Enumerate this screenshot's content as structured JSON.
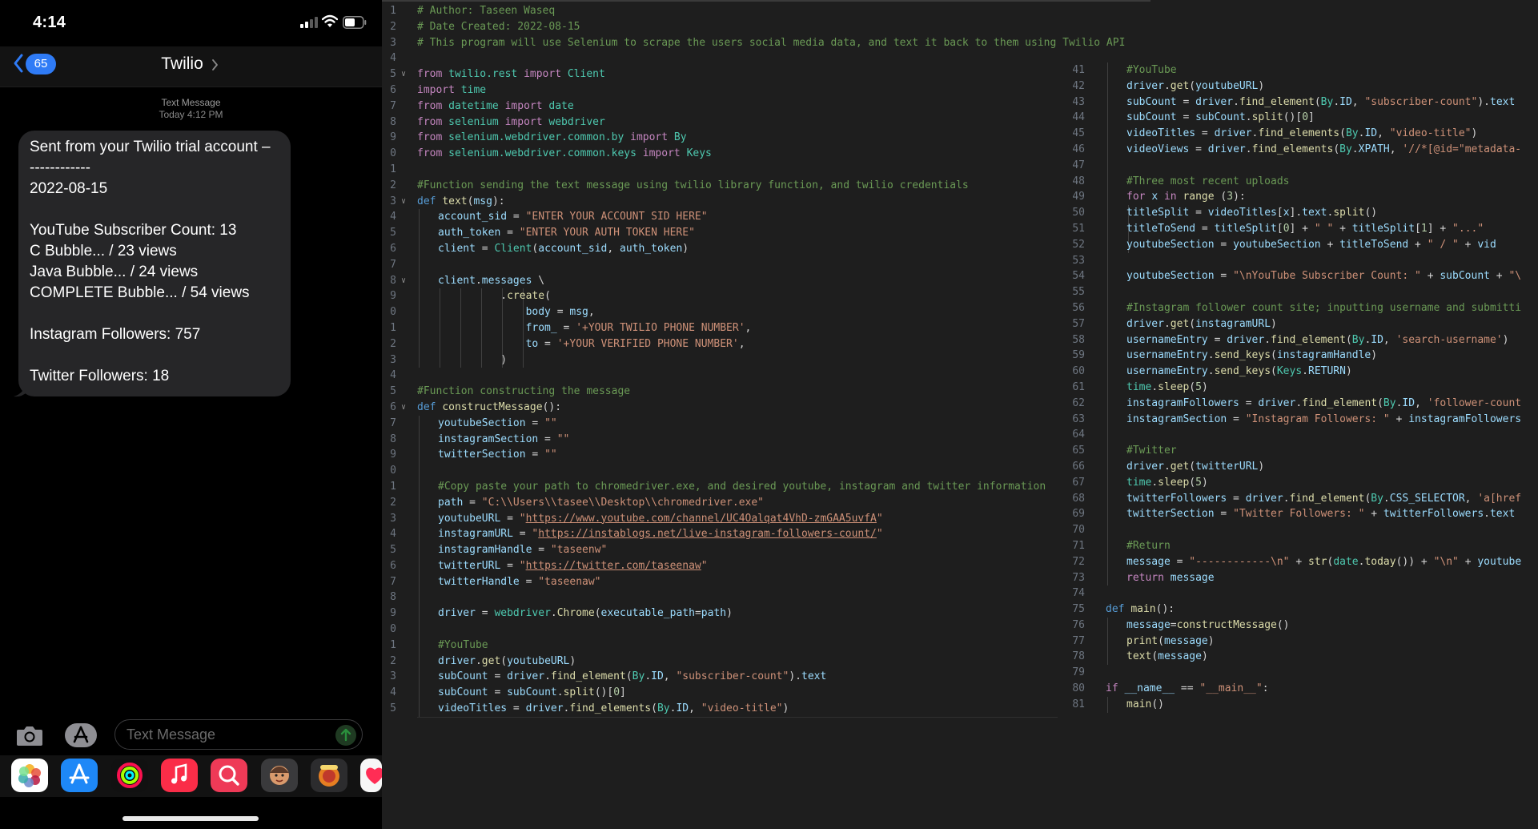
{
  "phone": {
    "status": {
      "time": "4:14"
    },
    "nav": {
      "unread_count": "65",
      "contact": "Twilio"
    },
    "thread": {
      "label": "Text Message",
      "timestamp": "Today 4:12 PM"
    },
    "message_lines": [
      "Sent from your Twilio trial account –",
      "------------",
      "2022-08-15",
      "",
      "YouTube Subscriber Count: 13",
      "C Bubble... / 23 views",
      "Java Bubble... / 24 views",
      "COMPLETE Bubble... / 54 views",
      "",
      "Instagram Followers: 757",
      "",
      "Twitter Followers: 18"
    ],
    "composer": {
      "placeholder": "Text Message"
    },
    "icons": {
      "camera": "camera-icon",
      "apps": "app-store-icon",
      "send": "send-arrow-icon"
    },
    "drawer_apps": [
      "photos-icon",
      "app-store-icon",
      "activity-icon",
      "music-icon",
      "search-icon",
      "memoji-icon",
      "avatar-icon",
      "heart-icon"
    ],
    "colors": {
      "badge": "#2f7bf6",
      "bubble": "#262628"
    }
  },
  "editor": {
    "left_pane": [
      {
        "n": "1",
        "fold": false,
        "indent": 0,
        "html": "<span class='cm'># Author: Taseen Waseq</span>"
      },
      {
        "n": "2",
        "fold": false,
        "indent": 0,
        "html": "<span class='cm'># Date Created: 2022-08-15</span>"
      },
      {
        "n": "3",
        "fold": false,
        "indent": 0,
        "html": "<span class='cm'># This program will use Selenium to scrape the users social media data, and text it back to them using Twilio API</span>"
      },
      {
        "n": "4",
        "fold": false,
        "indent": 0,
        "html": ""
      },
      {
        "n": "5",
        "fold": true,
        "indent": 0,
        "html": "<span class='kw'>from</span> <span class='cls'>twilio.rest</span> <span class='kw'>import</span> <span class='cls'>Client</span>"
      },
      {
        "n": "6",
        "fold": false,
        "indent": 0,
        "html": "<span class='kw'>import</span> <span class='cls'>time</span>"
      },
      {
        "n": "7",
        "fold": false,
        "indent": 0,
        "html": "<span class='kw'>from</span> <span class='cls'>datetime</span> <span class='kw'>import</span> <span class='cls'>date</span>"
      },
      {
        "n": "8",
        "fold": false,
        "indent": 0,
        "html": "<span class='kw'>from</span> <span class='cls'>selenium</span> <span class='kw'>import</span> <span class='cls'>webdriver</span>"
      },
      {
        "n": "9",
        "fold": false,
        "indent": 0,
        "html": "<span class='kw'>from</span> <span class='cls'>selenium.webdriver.common.by</span> <span class='kw'>import</span> <span class='cls'>By</span>"
      },
      {
        "n": "0",
        "fold": false,
        "indent": 0,
        "html": "<span class='kw'>from</span> <span class='cls'>selenium.webdriver.common.keys</span> <span class='kw'>import</span> <span class='cls'>Keys</span>"
      },
      {
        "n": "1",
        "fold": false,
        "indent": 0,
        "html": ""
      },
      {
        "n": "2",
        "fold": false,
        "indent": 0,
        "html": "<span class='cm'>#Function sending the text message using twilio library function, and twilio credentials</span>"
      },
      {
        "n": "3",
        "fold": true,
        "indent": 0,
        "html": "<span class='df'>def</span> <span class='fn'>text</span>(<span class='var'>msg</span>):"
      },
      {
        "n": "4",
        "fold": false,
        "indent": 1,
        "html": "<span class='var'>account_sid</span> = <span class='str'>\"ENTER YOUR ACCOUNT SID HERE\"</span>"
      },
      {
        "n": "5",
        "fold": false,
        "indent": 1,
        "html": "<span class='var'>auth_token</span> = <span class='str'>\"ENTER YOUR AUTH TOKEN HERE\"</span>"
      },
      {
        "n": "6",
        "fold": false,
        "indent": 1,
        "html": "<span class='var'>client</span> = <span class='cls'>Client</span>(<span class='var'>account_sid</span>, <span class='var'>auth_token</span>)"
      },
      {
        "n": "7",
        "fold": false,
        "indent": 1,
        "html": ""
      },
      {
        "n": "8",
        "fold": true,
        "indent": 1,
        "html": "<span class='var'>client</span>.<span class='var'>messages</span> \\"
      },
      {
        "n": "9",
        "fold": false,
        "indent": 6,
        "html": "          .<span class='fn'>create</span>("
      },
      {
        "n": "0",
        "fold": false,
        "indent": 6,
        "html": "              <span class='var'>body</span> = <span class='var'>msg</span>,"
      },
      {
        "n": "1",
        "fold": false,
        "indent": 6,
        "html": "              <span class='var'>from_</span> = <span class='str'>'+YOUR TWILIO PHONE NUMBER'</span>,"
      },
      {
        "n": "2",
        "fold": false,
        "indent": 6,
        "html": "              <span class='var'>to</span> = <span class='str'>'+YOUR VERIFIED PHONE NUMBER'</span>,"
      },
      {
        "n": "3",
        "fold": false,
        "indent": 6,
        "html": "          )"
      },
      {
        "n": "4",
        "fold": false,
        "indent": 0,
        "html": ""
      },
      {
        "n": "5",
        "fold": false,
        "indent": 0,
        "html": "<span class='cm'>#Function constructing the message</span>"
      },
      {
        "n": "6",
        "fold": true,
        "indent": 0,
        "html": "<span class='df'>def</span> <span class='fn'>constructMessage</span>():"
      },
      {
        "n": "7",
        "fold": false,
        "indent": 1,
        "html": "<span class='var'>youtubeSection</span> = <span class='str'>\"\"</span>"
      },
      {
        "n": "8",
        "fold": false,
        "indent": 1,
        "html": "<span class='var'>instagramSection</span> = <span class='str'>\"\"</span>"
      },
      {
        "n": "9",
        "fold": false,
        "indent": 1,
        "html": "<span class='var'>twitterSection</span> = <span class='str'>\"\"</span>"
      },
      {
        "n": "0",
        "fold": false,
        "indent": 1,
        "html": ""
      },
      {
        "n": "1",
        "fold": false,
        "indent": 1,
        "html": "<span class='cm'>#Copy paste your path to chromedriver.exe, and desired youtube, instagram and twitter information</span>"
      },
      {
        "n": "2",
        "fold": false,
        "indent": 1,
        "html": "<span class='var'>path</span> = <span class='str'>\"C:\\\\Users\\\\tasee\\\\Desktop\\\\chromedriver.exe\"</span>"
      },
      {
        "n": "3",
        "fold": false,
        "indent": 1,
        "html": "<span class='var'>youtubeURL</span> = <span class='str'>\"<span class='u'>https://www.youtube.com/channel/UC4Oalqat4VhD-zmGAA5uvfA</span>\"</span>"
      },
      {
        "n": "4",
        "fold": false,
        "indent": 1,
        "html": "<span class='var'>instagramURL</span> = <span class='str'>\"<span class='u'>https://instablogs.net/live-instagram-followers-count/</span>\"</span>"
      },
      {
        "n": "5",
        "fold": false,
        "indent": 1,
        "html": "<span class='var'>instagramHandle</span> = <span class='str'>\"taseenw\"</span>"
      },
      {
        "n": "6",
        "fold": false,
        "indent": 1,
        "html": "<span class='var'>twitterURL</span> = <span class='str'>\"<span class='u'>https://twitter.com/taseenaw</span>\"</span>"
      },
      {
        "n": "7",
        "fold": false,
        "indent": 1,
        "html": "<span class='var'>twitterHandle</span> = <span class='str'>\"taseenaw\"</span>"
      },
      {
        "n": "8",
        "fold": false,
        "indent": 1,
        "html": ""
      },
      {
        "n": "9",
        "fold": false,
        "indent": 1,
        "html": "<span class='var'>driver</span> = <span class='cls'>webdriver</span>.<span class='fn'>Chrome</span>(<span class='var'>executable_path</span>=<span class='var'>path</span>)"
      },
      {
        "n": "0",
        "fold": false,
        "indent": 1,
        "html": ""
      },
      {
        "n": "1",
        "fold": false,
        "indent": 1,
        "html": "<span class='cm'>#YouTube</span>"
      },
      {
        "n": "2",
        "fold": false,
        "indent": 1,
        "html": "<span class='var'>driver</span>.<span class='fn'>get</span>(<span class='var'>youtubeURL</span>)"
      },
      {
        "n": "3",
        "fold": false,
        "indent": 1,
        "html": "<span class='var'>subCount</span> = <span class='var'>driver</span>.<span class='fn'>find_element</span>(<span class='cls'>By</span>.<span class='var'>ID</span>, <span class='str'>\"subscriber-count\"</span>).<span class='var'>text</span>"
      },
      {
        "n": "4",
        "fold": false,
        "indent": 1,
        "html": "<span class='var'>subCount</span> = <span class='var'>subCount</span>.<span class='fn'>split</span>()[<span class='num'>0</span>]"
      },
      {
        "n": "5",
        "fold": false,
        "indent": 1,
        "html": "<span class='var'>videoTitles</span> = <span class='var'>driver</span>.<span class='fn'>find_elements</span>(<span class='cls'>By</span>.<span class='var'>ID</span>, <span class='str'>\"video-title\"</span>)"
      }
    ],
    "right_pane": [
      {
        "n": "41",
        "fold": false,
        "indent": 1,
        "html": "<span class='cm'>#YouTube</span>"
      },
      {
        "n": "42",
        "fold": false,
        "indent": 1,
        "html": "<span class='var'>driver</span>.<span class='fn'>get</span>(<span class='var'>youtubeURL</span>)"
      },
      {
        "n": "43",
        "fold": false,
        "indent": 1,
        "html": "<span class='var'>subCount</span> = <span class='var'>driver</span>.<span class='fn'>find_element</span>(<span class='cls'>By</span>.<span class='var'>ID</span>, <span class='str'>\"subscriber-count\"</span>).<span class='var'>text</span>"
      },
      {
        "n": "44",
        "fold": false,
        "indent": 1,
        "html": "<span class='var'>subCount</span> = <span class='var'>subCount</span>.<span class='fn'>split</span>()[<span class='num'>0</span>]"
      },
      {
        "n": "45",
        "fold": false,
        "indent": 1,
        "html": "<span class='var'>videoTitles</span> = <span class='var'>driver</span>.<span class='fn'>find_elements</span>(<span class='cls'>By</span>.<span class='var'>ID</span>, <span class='str'>\"video-title\"</span>)"
      },
      {
        "n": "46",
        "fold": false,
        "indent": 1,
        "html": "<span class='var'>videoViews</span> = <span class='var'>driver</span>.<span class='fn'>find_elements</span>(<span class='cls'>By</span>.<span class='var'>XPATH</span>, <span class='str'>'//*[@id=\"metadata-</span>"
      },
      {
        "n": "47",
        "fold": false,
        "indent": 1,
        "html": ""
      },
      {
        "n": "48",
        "fold": false,
        "indent": 1,
        "html": "<span class='cm'>#Three most recent uploads</span>"
      },
      {
        "n": "49",
        "fold": false,
        "indent": 1,
        "html": "<span class='kw'>for</span> <span class='var'>x</span> <span class='kw'>in</span> <span class='fn'>range</span> (<span class='num'>3</span>):"
      },
      {
        "n": "50",
        "fold": false,
        "indent": 2,
        "html": "<span class='var'>titleSplit</span> = <span class='var'>videoTitles</span>[<span class='var'>x</span>].<span class='var'>text</span>.<span class='fn'>split</span>()"
      },
      {
        "n": "51",
        "fold": false,
        "indent": 2,
        "html": "<span class='var'>titleToSend</span> = <span class='var'>titleSplit</span>[<span class='num'>0</span>] + <span class='str'>\" \"</span> + <span class='var'>titleSplit</span>[<span class='num'>1</span>] + <span class='str'>\"...\"</span>"
      },
      {
        "n": "52",
        "fold": false,
        "indent": 2,
        "html": "<span class='var'>youtubeSection</span> = <span class='var'>youtubeSection</span> + <span class='var'>titleToSend</span> + <span class='str'>\" / \"</span> + <span class='var'>vid</span>"
      },
      {
        "n": "53",
        "fold": false,
        "indent": 1,
        "html": ""
      },
      {
        "n": "54",
        "fold": false,
        "indent": 1,
        "html": "<span class='var'>youtubeSection</span> = <span class='str'>\"\\nYouTube Subscriber Count: \"</span> + <span class='var'>subCount</span> + <span class='str'>\"\\</span>"
      },
      {
        "n": "55",
        "fold": false,
        "indent": 1,
        "html": ""
      },
      {
        "n": "56",
        "fold": false,
        "indent": 1,
        "html": "<span class='cm'>#Instagram follower count site; inputting username and submitti</span>"
      },
      {
        "n": "57",
        "fold": false,
        "indent": 1,
        "html": "<span class='var'>driver</span>.<span class='fn'>get</span>(<span class='var'>instagramURL</span>)"
      },
      {
        "n": "58",
        "fold": false,
        "indent": 1,
        "html": "<span class='var'>usernameEntry</span> = <span class='var'>driver</span>.<span class='fn'>find_element</span>(<span class='cls'>By</span>.<span class='var'>ID</span>, <span class='str'>'search-username'</span>)"
      },
      {
        "n": "59",
        "fold": false,
        "indent": 1,
        "html": "<span class='var'>usernameEntry</span>.<span class='fn'>send_keys</span>(<span class='var'>instagramHandle</span>)"
      },
      {
        "n": "60",
        "fold": false,
        "indent": 1,
        "html": "<span class='var'>usernameEntry</span>.<span class='fn'>send_keys</span>(<span class='cls'>Keys</span>.<span class='var'>RETURN</span>)"
      },
      {
        "n": "61",
        "fold": false,
        "indent": 1,
        "html": "<span class='cls'>time</span>.<span class='fn'>sleep</span>(<span class='num'>5</span>)"
      },
      {
        "n": "62",
        "fold": false,
        "indent": 1,
        "html": "<span class='var'>instagramFollowers</span> = <span class='var'>driver</span>.<span class='fn'>find_element</span>(<span class='cls'>By</span>.<span class='var'>ID</span>, <span class='str'>'follower-count</span>"
      },
      {
        "n": "63",
        "fold": false,
        "indent": 1,
        "html": "<span class='var'>instagramSection</span> = <span class='str'>\"Instagram Followers: \"</span> + <span class='var'>instagramFollowers</span>"
      },
      {
        "n": "64",
        "fold": false,
        "indent": 1,
        "html": ""
      },
      {
        "n": "65",
        "fold": false,
        "indent": 1,
        "html": "<span class='cm'>#Twitter</span>"
      },
      {
        "n": "66",
        "fold": false,
        "indent": 1,
        "html": "<span class='var'>driver</span>.<span class='fn'>get</span>(<span class='var'>twitterURL</span>)"
      },
      {
        "n": "67",
        "fold": false,
        "indent": 1,
        "html": "<span class='cls'>time</span>.<span class='fn'>sleep</span>(<span class='num'>5</span>)"
      },
      {
        "n": "68",
        "fold": false,
        "indent": 1,
        "html": "<span class='var'>twitterFollowers</span> = <span class='var'>driver</span>.<span class='fn'>find_element</span>(<span class='cls'>By</span>.<span class='var'>CSS_SELECTOR</span>, <span class='str'>'a[href</span>"
      },
      {
        "n": "69",
        "fold": false,
        "indent": 1,
        "html": "<span class='var'>twitterSection</span> = <span class='str'>\"Twitter Followers: \"</span> + <span class='var'>twitterFollowers</span>.<span class='var'>text</span>"
      },
      {
        "n": "70",
        "fold": false,
        "indent": 1,
        "html": ""
      },
      {
        "n": "71",
        "fold": false,
        "indent": 1,
        "html": "<span class='cm'>#Return</span>"
      },
      {
        "n": "72",
        "fold": false,
        "indent": 1,
        "html": "<span class='var'>message</span> = <span class='str'>\"------------\\n\"</span> + <span class='fn'>str</span>(<span class='cls'>date</span>.<span class='fn'>today</span>()) + <span class='str'>\"\\n\"</span> + <span class='var'>youtube</span>"
      },
      {
        "n": "73",
        "fold": false,
        "indent": 1,
        "html": "<span class='kw'>return</span> <span class='var'>message</span>"
      },
      {
        "n": "74",
        "fold": false,
        "indent": 0,
        "html": ""
      },
      {
        "n": "75",
        "fold": false,
        "indent": 0,
        "html": "<span class='df'>def</span> <span class='fn'>main</span>():"
      },
      {
        "n": "76",
        "fold": false,
        "indent": 1,
        "html": "<span class='var'>message</span>=<span class='fn'>constructMessage</span>()"
      },
      {
        "n": "77",
        "fold": false,
        "indent": 1,
        "html": "<span class='fn'>print</span>(<span class='var'>message</span>)"
      },
      {
        "n": "78",
        "fold": false,
        "indent": 1,
        "html": "<span class='fn'>text</span>(<span class='var'>message</span>)"
      },
      {
        "n": "79",
        "fold": false,
        "indent": 0,
        "html": ""
      },
      {
        "n": "80",
        "fold": false,
        "indent": 0,
        "html": "<span class='kw'>if</span> <span class='var'>__name__</span> == <span class='str'>\"__main__\"</span>:"
      },
      {
        "n": "81",
        "fold": false,
        "indent": 1,
        "html": "<span class='fn'>main</span>()"
      }
    ]
  }
}
